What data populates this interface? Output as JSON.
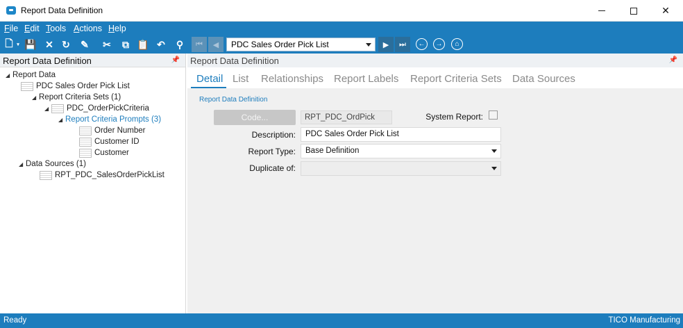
{
  "window": {
    "title": "Report Data Definition",
    "controls": {
      "minimize_icon": "minimize-icon",
      "maximize_icon": "maximize-icon",
      "close_glyph": "✕"
    }
  },
  "menu": [
    {
      "label": "File",
      "accel": "F",
      "rest": "ile"
    },
    {
      "label": "Edit",
      "accel": "E",
      "rest": "dit"
    },
    {
      "label": "Tools",
      "accel": "T",
      "rest": "ools"
    },
    {
      "label": "Actions",
      "accel": "A",
      "rest": "ctions"
    },
    {
      "label": "Help",
      "accel": "H",
      "rest": "elp"
    }
  ],
  "toolbar": {
    "icons": [
      {
        "name": "new-icon",
        "glyph": "🗋"
      },
      {
        "name": "save-icon",
        "glyph": "💾"
      },
      {
        "name": "delete-icon",
        "glyph": "✕"
      },
      {
        "name": "refresh-icon",
        "glyph": "↻"
      },
      {
        "name": "clear-icon",
        "glyph": "✎"
      },
      {
        "name": "cut-icon",
        "glyph": "✂"
      },
      {
        "name": "copy-icon",
        "glyph": "⧉"
      },
      {
        "name": "paste-icon",
        "glyph": "📋"
      },
      {
        "name": "undo-icon",
        "glyph": "↶"
      },
      {
        "name": "find-icon",
        "glyph": "⚲"
      }
    ],
    "record_selector": "PDC Sales Order Pick List",
    "nav": {
      "first_glyph": "⏮",
      "prev_glyph": "◀",
      "next_glyph": "▶",
      "last_glyph": "⏭",
      "back_glyph": "←",
      "forward_glyph": "→",
      "home_glyph": "⌂"
    }
  },
  "left_panel": {
    "title": "Report Data Definition",
    "tree": [
      {
        "label": "Report Data",
        "arrow": "◢",
        "icon": false
      },
      {
        "label": "PDC Sales Order Pick List",
        "arrow": "",
        "icon": true
      },
      {
        "label": "Report Criteria Sets (1)",
        "arrow": "◢",
        "icon": false
      },
      {
        "label": "PDC_OrderPickCriteria",
        "arrow": "◢",
        "icon": true
      },
      {
        "label": "Report Criteria Prompts (3)",
        "arrow": "◢",
        "icon": false,
        "selected": true
      },
      {
        "label": "Order Number",
        "arrow": "",
        "icon": true
      },
      {
        "label": "Customer ID",
        "arrow": "",
        "icon": true
      },
      {
        "label": "Customer",
        "arrow": "",
        "icon": true
      },
      {
        "label": "Data Sources (1)",
        "arrow": "◢",
        "icon": false
      },
      {
        "label": "RPT_PDC_SalesOrderPickList",
        "arrow": "",
        "icon": true
      }
    ]
  },
  "right_panel": {
    "title": "Report Data Definition",
    "tabs": [
      "Detail",
      "List",
      "Relationships",
      "Report Labels",
      "Report Criteria Sets",
      "Data Sources"
    ],
    "active_tab": "Detail",
    "section": "Report Data Definition",
    "form": {
      "code_button": "Code...",
      "code_value": "RPT_PDC_OrdPick",
      "system_report_label": "System Report:",
      "system_report_checked": false,
      "description_label": "Description:",
      "description_value": "PDC Sales Order Pick List",
      "report_type_label": "Report Type:",
      "report_type_value": "Base Definition",
      "duplicate_of_label": "Duplicate of:",
      "duplicate_of_value": ""
    }
  },
  "status": {
    "left": "Ready",
    "right": "TICO Manufacturing"
  },
  "colors": {
    "accent": "#1d7dbd",
    "panel_bg": "#f0f0f0"
  }
}
